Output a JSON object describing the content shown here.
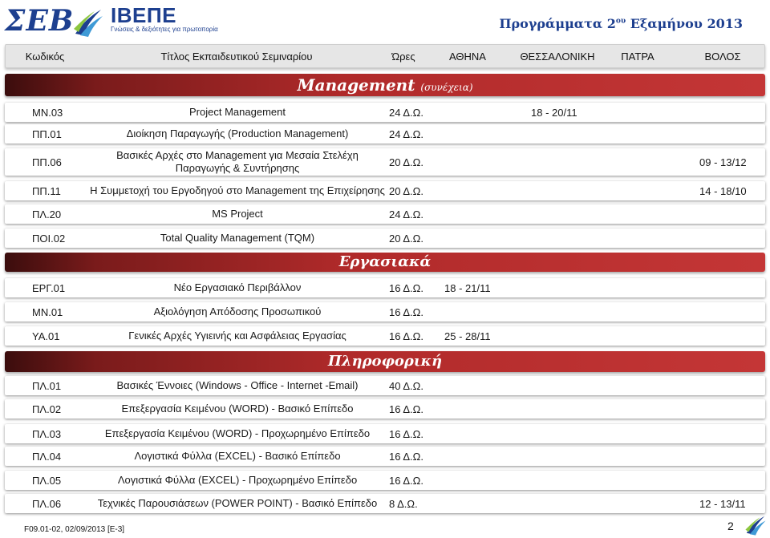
{
  "header": {
    "logo_sev": "ΣΕΒ",
    "logo_ibepe": "ΙΒΕΠΕ",
    "logo_ibepe_tagline": "Γνώσεις & δεξιότητες για πρωτοπορία",
    "program_title_pre": "Προγράμματα 2",
    "program_title_sup": "ου",
    "program_title_post": " Εξαμήνου 2013"
  },
  "columns": {
    "code": "Κωδικός",
    "title": "Τίτλος Εκπαιδευτικού Σεμιναρίου",
    "hours": "Ώρες",
    "athens": "ΑΘΗΝΑ",
    "thessaloniki": "ΘΕΣΣΑΛΟΝΙΚΗ",
    "patra": "ΠΑΤΡΑ",
    "volos": "ΒΟΛΟΣ"
  },
  "sections": [
    {
      "title": "Management",
      "subtitle": "(συνέχεια)",
      "rows": [
        {
          "code": "ΜΝ.03",
          "title": "Project Management",
          "hours": "24 Δ.Ω.",
          "athens": "",
          "thessaloniki": "18 - 20/11",
          "patra": "",
          "volos": ""
        },
        {
          "code": "ΠΠ.01",
          "title": "Διοίκηση Παραγωγής (Production Management)",
          "hours": "24 Δ.Ω.",
          "athens": "",
          "thessaloniki": "",
          "patra": "",
          "volos": ""
        },
        {
          "code": "ΠΠ.06",
          "title": "Βασικές Αρχές στο Management για Μεσαία Στελέχη Παραγωγής & Συντήρησης",
          "hours": "20 Δ.Ω.",
          "athens": "",
          "thessaloniki": "",
          "patra": "",
          "volos": "09 - 13/12"
        },
        {
          "code": "ΠΠ.11",
          "title": "Η Συμμετοχή του Εργοδηγού στο Management της Επιχείρησης",
          "hours": "20 Δ.Ω.",
          "athens": "",
          "thessaloniki": "",
          "patra": "",
          "volos": "14 - 18/10"
        },
        {
          "code": "ΠΛ.20",
          "title": "MS Project",
          "hours": "24 Δ.Ω.",
          "athens": "",
          "thessaloniki": "",
          "patra": "",
          "volos": ""
        },
        {
          "code": "ΠΟΙ.02",
          "title": "Total Quality Management (TQM)",
          "hours": "20 Δ.Ω.",
          "athens": "",
          "thessaloniki": "",
          "patra": "",
          "volos": ""
        }
      ]
    },
    {
      "title": "Εργασιακά",
      "subtitle": "",
      "rows": [
        {
          "code": "ΕΡΓ.01",
          "title": "Νέο Εργασιακό Περιβάλλον",
          "hours": "16 Δ.Ω.",
          "athens": "18 - 21/11",
          "thessaloniki": "",
          "patra": "",
          "volos": ""
        },
        {
          "code": "ΜΝ.01",
          "title": "Αξιολόγηση Απόδοσης Προσωπικού",
          "hours": "16 Δ.Ω.",
          "athens": "",
          "thessaloniki": "",
          "patra": "",
          "volos": ""
        },
        {
          "code": "ΥΑ.01",
          "title": "Γενικές Αρχές Υγιεινής και Ασφάλειας Εργασίας",
          "hours": "16 Δ.Ω.",
          "athens": "25 - 28/11",
          "thessaloniki": "",
          "patra": "",
          "volos": ""
        }
      ]
    },
    {
      "title": "Πληροφορική",
      "subtitle": "",
      "rows": [
        {
          "code": "ΠΛ.01",
          "title": "Βασικές Έννοιες (Windows - Office - Internet -Email)",
          "hours": "40 Δ.Ω.",
          "athens": "",
          "thessaloniki": "",
          "patra": "",
          "volos": ""
        },
        {
          "code": "ΠΛ.02",
          "title": "Επεξεργασία Κειμένου (WORD) - Βασικό Επίπεδο",
          "hours": "16 Δ.Ω.",
          "athens": "",
          "thessaloniki": "",
          "patra": "",
          "volos": ""
        },
        {
          "code": "ΠΛ.03",
          "title": "Επεξεργασία Κειμένου (WORD) - Προχωρημένο Επίπεδο",
          "hours": "16 Δ.Ω.",
          "athens": "",
          "thessaloniki": "",
          "patra": "",
          "volos": ""
        },
        {
          "code": "ΠΛ.04",
          "title": "Λογιστικά Φύλλα (EXCEL) - Βασικό Επίπεδο",
          "hours": "16 Δ.Ω.",
          "athens": "",
          "thessaloniki": "",
          "patra": "",
          "volos": ""
        },
        {
          "code": "ΠΛ.05",
          "title": "Λογιστικά Φύλλα (EXCEL) - Προχωρημένο Επίπεδο",
          "hours": "16 Δ.Ω.",
          "athens": "",
          "thessaloniki": "",
          "patra": "",
          "volos": ""
        },
        {
          "code": "ΠΛ.06",
          "title": "Τεχνικές Παρουσιάσεων (POWER POINT) - Βασικό Επίπεδο",
          "hours": "8 Δ.Ω.",
          "athens": "",
          "thessaloniki": "",
          "patra": "",
          "volos": "12 - 13/11"
        }
      ]
    }
  ],
  "footer": {
    "doc_code": "F09.01-02, 02/09/2013 [Ε-3]",
    "page_number": "2"
  },
  "colors": {
    "brand_blue": "#1d3f8f",
    "banner_red": "#b02a2a",
    "banner_dark": "#3b0d0d",
    "header_gray": "#e6e6e6"
  },
  "icons": [
    "sev-swoosh-icon",
    "footer-swoosh-icon"
  ]
}
